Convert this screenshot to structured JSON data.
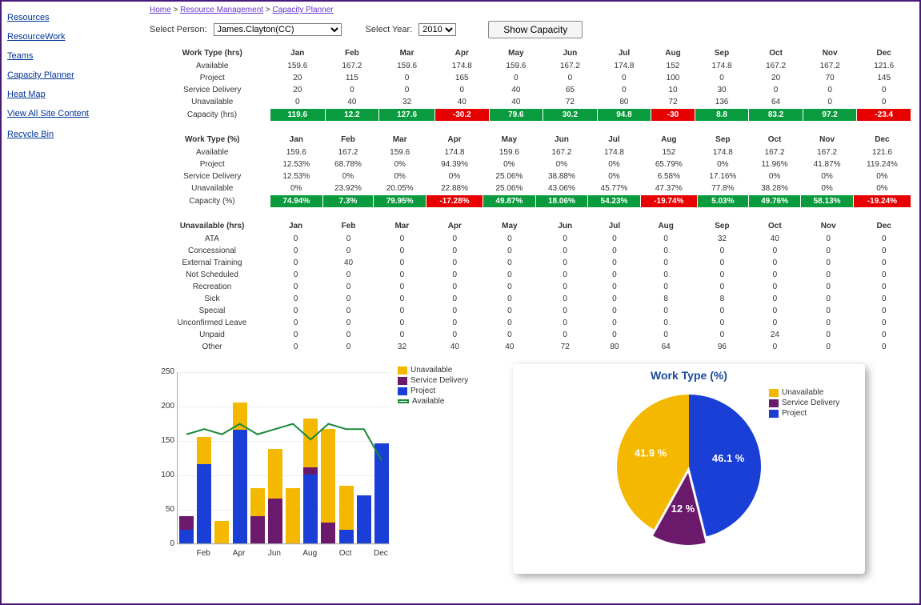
{
  "breadcrumb": {
    "home": "Home",
    "rm": "Resource Management",
    "cp": "Capacity Planner",
    "sep": " > "
  },
  "sidebar": {
    "items": [
      "Resources",
      "ResourceWork",
      "Teams",
      "Capacity Planner",
      "Heat Map",
      "View All Site Content",
      "Recycle Bin"
    ]
  },
  "controls": {
    "personLabel": "Select Person:",
    "personValue": "James.Clayton(CC)",
    "yearLabel": "Select Year:",
    "yearValue": "2010",
    "button": "Show Capacity"
  },
  "months": [
    "Jan",
    "Feb",
    "Mar",
    "Apr",
    "May",
    "Jun",
    "Jul",
    "Aug",
    "Sep",
    "Oct",
    "Nov",
    "Dec"
  ],
  "table1": {
    "title": "Work Type (hrs)",
    "rows": [
      {
        "label": "Available",
        "v": [
          159.6,
          167.2,
          159.6,
          174.8,
          159.6,
          167.2,
          174.8,
          152,
          174.8,
          167.2,
          167.2,
          121.6
        ]
      },
      {
        "label": "Project",
        "v": [
          20,
          115,
          0,
          165,
          0,
          0,
          0,
          100,
          0,
          20,
          70,
          145
        ]
      },
      {
        "label": "Service Delivery",
        "v": [
          20,
          0,
          0,
          0,
          40,
          65,
          0,
          10,
          30,
          0,
          0,
          0
        ]
      },
      {
        "label": "Unavailable",
        "v": [
          0,
          40,
          32,
          40,
          40,
          72,
          80,
          72,
          136,
          64,
          0,
          0
        ]
      }
    ],
    "capLabel": "Capacity (hrs)",
    "cap": [
      119.6,
      12.2,
      127.6,
      -30.2,
      79.6,
      30.2,
      94.8,
      -30,
      8.8,
      83.2,
      97.2,
      -23.4
    ]
  },
  "table2": {
    "title": "Work Type (%)",
    "rows": [
      {
        "label": "Available",
        "v": [
          "159.6",
          "167.2",
          "159.6",
          "174.8",
          "159.6",
          "167.2",
          "174.8",
          "152",
          "174.8",
          "167.2",
          "167.2",
          "121.6"
        ]
      },
      {
        "label": "Project",
        "v": [
          "12.53%",
          "68.78%",
          "0%",
          "94.39%",
          "0%",
          "0%",
          "0%",
          "65.79%",
          "0%",
          "11.96%",
          "41.87%",
          "119.24%"
        ]
      },
      {
        "label": "Service Delivery",
        "v": [
          "12.53%",
          "0%",
          "0%",
          "0%",
          "25.06%",
          "38.88%",
          "0%",
          "6.58%",
          "17.16%",
          "0%",
          "0%",
          "0%"
        ]
      },
      {
        "label": "Unavailable",
        "v": [
          "0%",
          "23.92%",
          "20.05%",
          "22.88%",
          "25.06%",
          "43.06%",
          "45.77%",
          "47.37%",
          "77.8%",
          "38.28%",
          "0%",
          "0%"
        ]
      }
    ],
    "capLabel": "Capacity (%)",
    "cap": [
      "74.94%",
      "7.3%",
      "79.95%",
      "-17.28%",
      "49.87%",
      "18.06%",
      "54.23%",
      "-19.74%",
      "5.03%",
      "49.76%",
      "58.13%",
      "-19.24%"
    ]
  },
  "table3": {
    "title": "Unavailable (hrs)",
    "rows": [
      {
        "label": "ATA",
        "v": [
          0,
          0,
          0,
          0,
          0,
          0,
          0,
          0,
          32,
          40,
          0,
          0
        ]
      },
      {
        "label": "Concessional",
        "v": [
          0,
          0,
          0,
          0,
          0,
          0,
          0,
          0,
          0,
          0,
          0,
          0
        ]
      },
      {
        "label": "External Training",
        "v": [
          0,
          40,
          0,
          0,
          0,
          0,
          0,
          0,
          0,
          0,
          0,
          0
        ]
      },
      {
        "label": "Not Scheduled",
        "v": [
          0,
          0,
          0,
          0,
          0,
          0,
          0,
          0,
          0,
          0,
          0,
          0
        ]
      },
      {
        "label": "Recreation",
        "v": [
          0,
          0,
          0,
          0,
          0,
          0,
          0,
          0,
          0,
          0,
          0,
          0
        ]
      },
      {
        "label": "Sick",
        "v": [
          0,
          0,
          0,
          0,
          0,
          0,
          0,
          8,
          8,
          0,
          0,
          0
        ]
      },
      {
        "label": "Special",
        "v": [
          0,
          0,
          0,
          0,
          0,
          0,
          0,
          0,
          0,
          0,
          0,
          0
        ]
      },
      {
        "label": "Unconfirmed Leave",
        "v": [
          0,
          0,
          0,
          0,
          0,
          0,
          0,
          0,
          0,
          0,
          0,
          0
        ]
      },
      {
        "label": "Unpaid",
        "v": [
          0,
          0,
          0,
          0,
          0,
          0,
          0,
          0,
          0,
          24,
          0,
          0
        ]
      },
      {
        "label": "Other",
        "v": [
          0,
          0,
          32,
          40,
          40,
          72,
          80,
          64,
          96,
          0,
          0,
          0
        ]
      }
    ]
  },
  "legend": {
    "unavailable": "Unavailable",
    "service": "Service Delivery",
    "project": "Project",
    "available": "Available"
  },
  "colors": {
    "unavailable": "#f5b800",
    "service": "#6b1a6b",
    "project": "#1a3fd6",
    "available": "#1a8a3a"
  },
  "pie": {
    "title": "Work Type (%)",
    "slices": [
      {
        "label": "Project",
        "pct": 46.1
      },
      {
        "label": "Service Delivery",
        "pct": 12.0
      },
      {
        "label": "Unavailable",
        "pct": 41.9
      }
    ]
  },
  "chart_data": [
    {
      "type": "bar",
      "title": "",
      "ylim": [
        0,
        250
      ],
      "categories": [
        "Jan",
        "Feb",
        "Mar",
        "Apr",
        "May",
        "Jun",
        "Jul",
        "Aug",
        "Sep",
        "Oct",
        "Nov",
        "Dec"
      ],
      "series": [
        {
          "name": "Project",
          "values": [
            20,
            115,
            0,
            165,
            0,
            0,
            0,
            100,
            0,
            20,
            70,
            145
          ]
        },
        {
          "name": "Service Delivery",
          "values": [
            20,
            0,
            0,
            0,
            40,
            65,
            0,
            10,
            30,
            0,
            0,
            0
          ]
        },
        {
          "name": "Unavailable",
          "values": [
            0,
            40,
            32,
            40,
            40,
            72,
            80,
            72,
            136,
            64,
            0,
            0
          ]
        },
        {
          "name": "Available",
          "values": [
            159.6,
            167.2,
            159.6,
            174.8,
            159.6,
            167.2,
            174.8,
            152,
            174.8,
            167.2,
            167.2,
            121.6
          ],
          "type": "line"
        }
      ]
    },
    {
      "type": "pie",
      "title": "Work Type (%)",
      "series": [
        {
          "name": "Project",
          "value": 46.1
        },
        {
          "name": "Service Delivery",
          "value": 12.0
        },
        {
          "name": "Unavailable",
          "value": 41.9
        }
      ]
    }
  ]
}
